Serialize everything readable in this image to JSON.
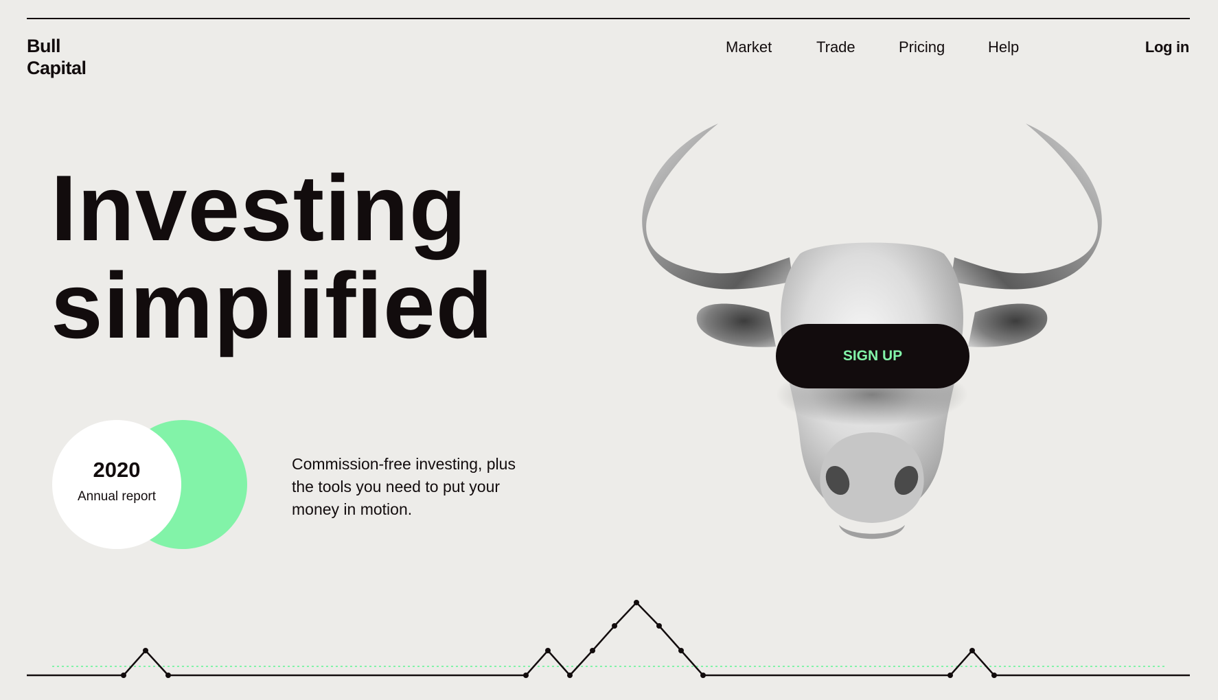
{
  "brand": {
    "line1": "Bull",
    "line2": "Capital"
  },
  "nav": {
    "items": [
      "Market",
      "Trade",
      "Pricing",
      "Help"
    ],
    "login_label": "Log in"
  },
  "hero": {
    "headline_line1": "Investing",
    "headline_line2": "simplified",
    "tagline": "Commission-free investing, plus the tools you need to put your money in motion.",
    "cta_label": "SIGN UP"
  },
  "report": {
    "year": "2020",
    "label": "Annual report"
  },
  "colors": {
    "background": "#edece9",
    "ink": "#120c0d",
    "accent": "#82f3a8"
  },
  "icons": {
    "hero_image": "bull-head-icon",
    "decoration": "ticker-line-icon"
  }
}
